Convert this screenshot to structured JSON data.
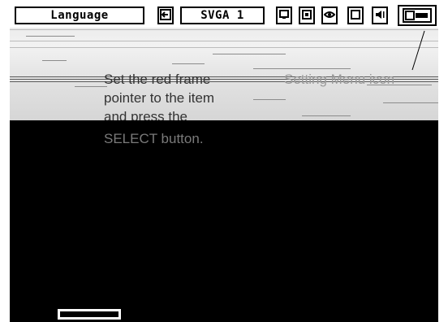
{
  "menubar": {
    "language_label": "Language",
    "display_mode_label": "SVGA 1",
    "icons": [
      "exit-icon",
      "pc-adjust-icon",
      "image-select-icon",
      "image-adjust-icon",
      "screen-icon",
      "sound-icon",
      "setting-icon"
    ]
  },
  "instructions": {
    "line1": "Set the red frame",
    "line2": "pointer to the item",
    "line3": "and press the",
    "line4": "SELECT button."
  },
  "callout": {
    "label": "Setting Menu icon"
  }
}
